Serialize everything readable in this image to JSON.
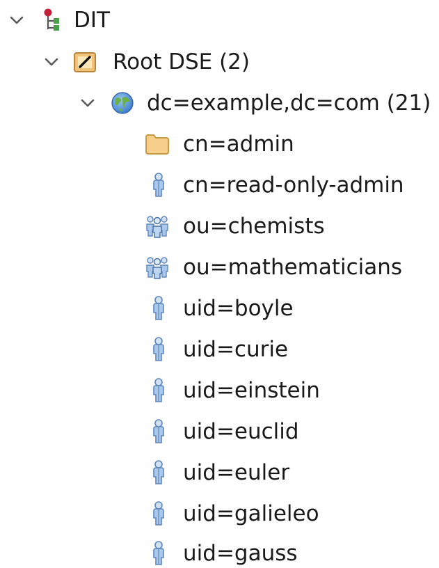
{
  "tree": {
    "dit": {
      "label": "DIT",
      "icon": "dit-tree-icon",
      "expanded": true
    },
    "root_dse": {
      "label": "Root DSE (2)",
      "icon": "root-dse-icon",
      "expanded": true
    },
    "base": {
      "label": "dc=example,dc=com (21)",
      "icon": "globe-icon",
      "expanded": true
    },
    "entries": [
      {
        "label": "cn=admin",
        "icon": "folder-icon"
      },
      {
        "label": "cn=read-only-admin",
        "icon": "person-icon"
      },
      {
        "label": "ou=chemists",
        "icon": "group-icon"
      },
      {
        "label": "ou=mathematicians",
        "icon": "group-icon"
      },
      {
        "label": "uid=boyle",
        "icon": "person-icon"
      },
      {
        "label": "uid=curie",
        "icon": "person-icon"
      },
      {
        "label": "uid=einstein",
        "icon": "person-icon"
      },
      {
        "label": "uid=euclid",
        "icon": "person-icon"
      },
      {
        "label": "uid=euler",
        "icon": "person-icon"
      },
      {
        "label": "uid=galieleo",
        "icon": "person-icon"
      },
      {
        "label": "uid=gauss",
        "icon": "person-icon"
      }
    ]
  },
  "colors": {
    "chevron": "#5a5a5a",
    "folder": "#f1c27a",
    "person": "#7ea6d8",
    "globe_ocean": "#3f7fd0",
    "globe_land": "#6cb04a",
    "dit_red": "#c2233a",
    "dit_green": "#4aa04a"
  }
}
